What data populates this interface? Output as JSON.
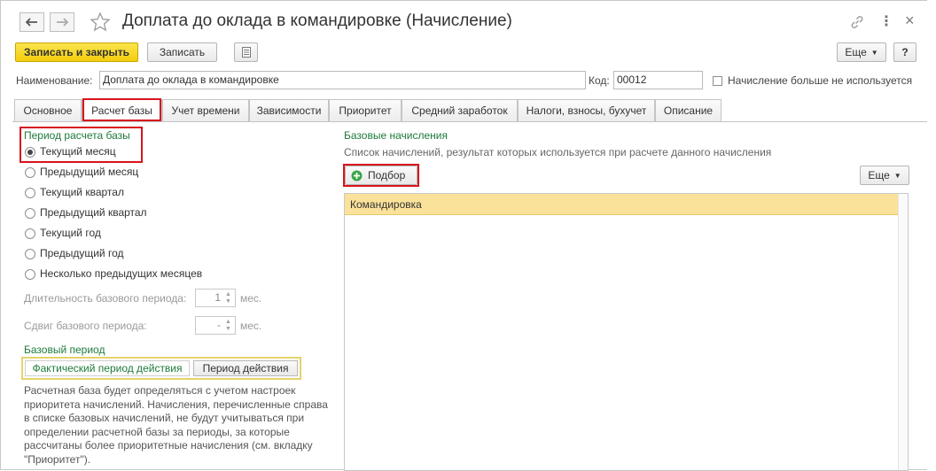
{
  "window": {
    "title": "Доплата до оклада в командировке (Начисление)",
    "more_icon": "⋮",
    "close_icon": "×"
  },
  "toolbar": {
    "save_close": "Записать и закрыть",
    "save": "Записать",
    "more": "Еще",
    "help": "?"
  },
  "form": {
    "name_label": "Наименование:",
    "name_value": "Доплата до оклада в командировке",
    "code_label": "Код:",
    "code_value": "00012",
    "not_used_label": "Начисление больше не используется"
  },
  "tabs": [
    {
      "label": "Основное"
    },
    {
      "label": "Расчет базы",
      "active": true
    },
    {
      "label": "Учет времени"
    },
    {
      "label": "Зависимости"
    },
    {
      "label": "Приоритет"
    },
    {
      "label": "Средний заработок"
    },
    {
      "label": "Налоги, взносы, бухучет"
    },
    {
      "label": "Описание"
    }
  ],
  "period": {
    "heading": "Период расчета базы",
    "options": [
      {
        "label": "Текущий месяц",
        "selected": true
      },
      {
        "label": "Предыдущий месяц"
      },
      {
        "label": "Текущий квартал"
      },
      {
        "label": "Предыдущий квартал"
      },
      {
        "label": "Текущий год"
      },
      {
        "label": "Предыдущий год"
      },
      {
        "label": "Несколько предыдущих месяцев"
      }
    ],
    "duration_label": "Длительность базового периода:",
    "duration_value": "1",
    "duration_unit": "мес.",
    "shift_label": "Сдвиг базового периода:",
    "shift_value": "-",
    "shift_unit": "мес."
  },
  "base_period": {
    "heading": "Базовый период",
    "opt_actual": "Фактический период действия",
    "opt_period": "Период действия",
    "description": "Расчетная база будет определяться с учетом настроек приоритета начислений. Начисления, перечисленные справа в списке базовых начислений, не будут учитываться при определении расчетной базы за периоды, за которые рассчитаны более приоритетные начисления (см. вкладку \"Приоритет\")."
  },
  "base_accruals": {
    "heading": "Базовые начисления",
    "description": "Список начислений, результат которых используется при расчете данного начисления",
    "select_button": "Подбор",
    "more": "Еще",
    "rows": [
      "Командировка"
    ]
  },
  "colors": {
    "accent_green": "#1e7a3b",
    "highlight_red": "#d7141d",
    "primary_yellow": "#f3cd0c",
    "row_selected": "#fbe29a"
  }
}
